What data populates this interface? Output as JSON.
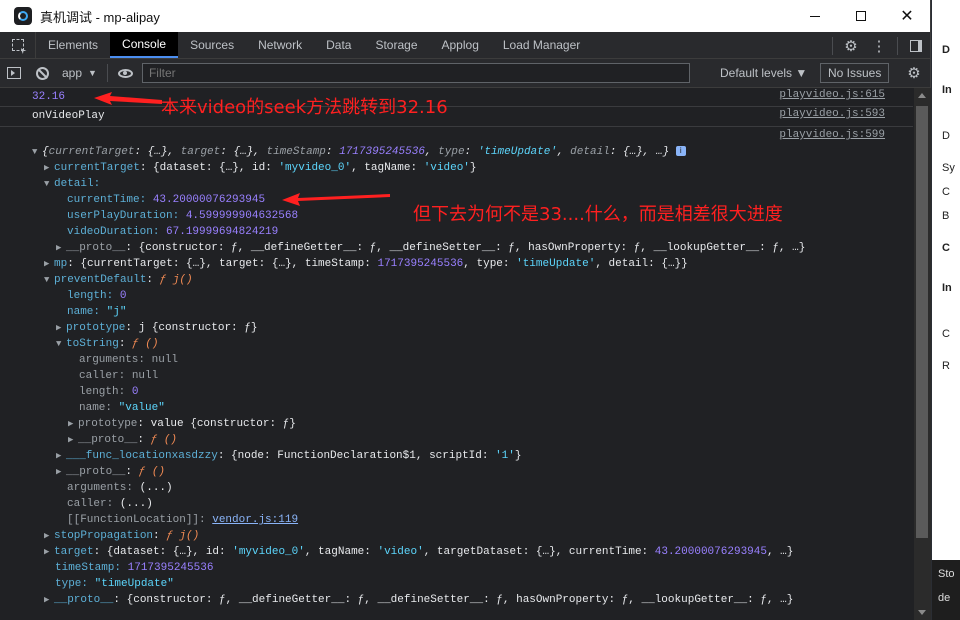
{
  "window": {
    "title": "真机调试 - mp-alipay"
  },
  "tabs": [
    "Elements",
    "Console",
    "Sources",
    "Network",
    "Data",
    "Storage",
    "Applog",
    "Load Manager"
  ],
  "active_tab": "Console",
  "toolbar": {
    "context": "app",
    "filter_placeholder": "Filter",
    "levels": "Default levels ▼",
    "issues": "No Issues"
  },
  "console": {
    "line1_value": "32.16",
    "line1_src": "playvideo.js:615",
    "line2_text": "onVideoPlay",
    "line2_src": "playvideo.js:593",
    "obj_src": "playvideo.js:599",
    "obj_summary": {
      "open": "{",
      "k1": "currentTarget",
      "v1": ": {…}, ",
      "k2": "target",
      "v2": ": {…}, ",
      "k3": "timeStamp",
      "v3": "1717395245536",
      "k4": "type",
      "v4": "'timeUpdate'",
      "k5": "detail",
      "v5": ": {…}, …}"
    },
    "currentTarget_line": {
      "key": "currentTarget",
      "p1": ": {dataset: {…}, id: ",
      "id": "'myvideo_0'",
      "p2": ", tagName: ",
      "tag": "'video'",
      "p3": "}"
    },
    "detail_key": "detail:",
    "detail": {
      "currentTime_key": "currentTime:",
      "currentTime": "43.20000076293945",
      "userPlayDuration_key": "userPlayDuration:",
      "userPlayDuration": "4.599999904632568",
      "videoDuration_key": "videoDuration:",
      "videoDuration": "67.19999694824219",
      "proto_key": "__proto__",
      "proto_val": ": {constructor: ƒ, __defineGetter__: ƒ, __defineSetter__: ƒ, hasOwnProperty: ƒ, __lookupGetter__: ƒ, …}"
    },
    "mp_line": {
      "key": "mp",
      "p1": ": {currentTarget: {…}, target: {…}, timeStamp: ",
      "ts": "1717395245536",
      "p2": ", type: ",
      "type": "'timeUpdate'",
      "p3": ", detail: {…}}"
    },
    "preventDefault": {
      "key": "preventDefault",
      "val": "ƒ j()",
      "length_key": "length:",
      "length": "0",
      "name_key": "name:",
      "name": "\"j\"",
      "prototype_key": "prototype",
      "prototype_val": ": j {constructor: ƒ}",
      "toString_key": "toString",
      "toString_val": "ƒ ()",
      "arguments_key": "arguments:",
      "arguments": "null",
      "caller_key": "caller:",
      "caller": "null",
      "ts_length_key": "length:",
      "ts_length": "0",
      "ts_name_key": "name:",
      "ts_name": "\"value\"",
      "ts_prototype_key": "prototype",
      "ts_prototype_val": ": value {constructor: ƒ}",
      "ts_proto_key": "__proto__",
      "ts_proto_val": "ƒ ()",
      "func_loc_key": "___func_locationxasdzzy",
      "func_loc_p1": ": {node: FunctionDeclaration$1, scriptId: ",
      "func_loc_id": "'1'",
      "func_loc_p2": "}",
      "proto_key": "__proto__",
      "proto_val": "ƒ ()",
      "args_key": "arguments:",
      "args_val": "(...)",
      "caller2_key": "caller:",
      "caller2_val": "(...)",
      "fl_label": "[[FunctionLocation]]:",
      "fl_link": "vendor.js:119"
    },
    "stopPropagation": {
      "key": "stopPropagation",
      "val": "ƒ j()"
    },
    "target_line": {
      "key": "target",
      "p1": ": {dataset: {…}, id: ",
      "id": "'myvideo_0'",
      "p2": ", tagName: ",
      "tag": "'video'",
      "p3": ", targetDataset: {…}, currentTime: ",
      "ct": "43.20000076293945",
      "p4": ", …}"
    },
    "timeStamp_key": "timeStamp:",
    "timeStamp": "1717395245536",
    "type_key": "type:",
    "type": "\"timeUpdate\"",
    "root_proto_key": "__proto__",
    "root_proto_val": ": {constructor: ƒ, __defineGetter__: ƒ, __defineSetter__: ƒ, hasOwnProperty: ƒ, __lookupGetter__: ƒ, …}"
  },
  "annotations": {
    "a1": "本来video的seek方法跳转到32.16",
    "a2": "但下去为何不是33....什么，而是相差很大进度"
  },
  "background_window": {
    "letters": [
      "D",
      "In",
      "D",
      "Sy",
      "C",
      "B",
      "C",
      "In",
      "C",
      "R",
      "Sto",
      "de"
    ]
  },
  "colors": {
    "annotation": "#ff2020",
    "key": "#5db0d7",
    "number": "#9980ff",
    "string": "#5cd5fb",
    "function": "#f28b54"
  }
}
